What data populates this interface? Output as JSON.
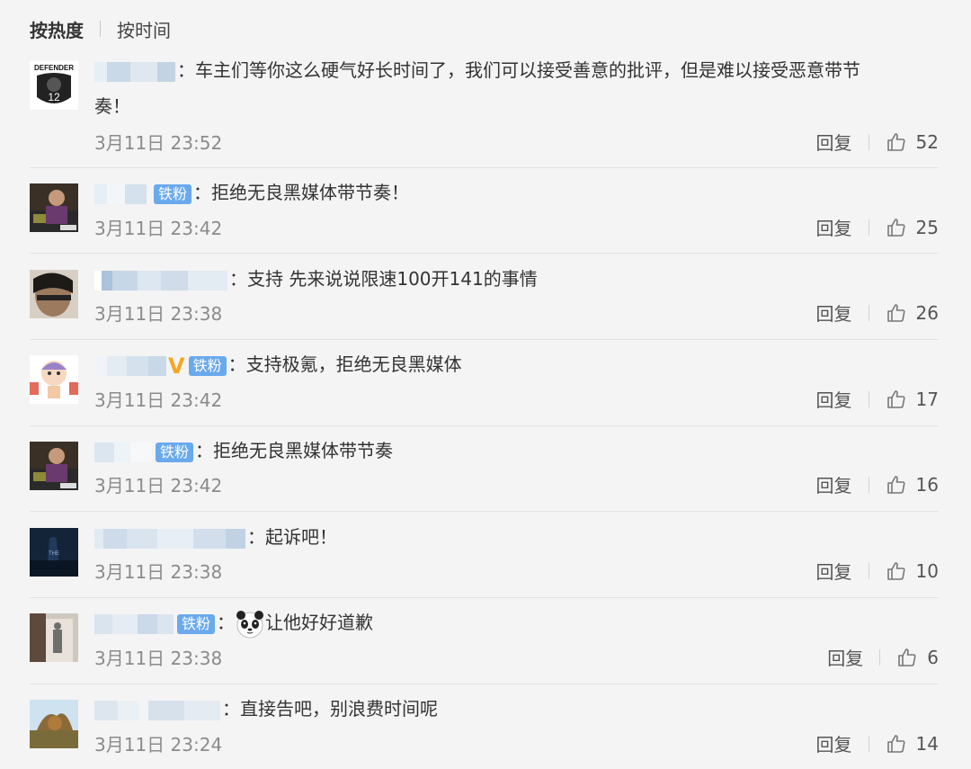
{
  "sort_tabs": {
    "hot": "按热度",
    "time": "按时间"
  },
  "reply_label": "回复",
  "colors": {
    "badge": "#6aa9ec",
    "vip": "#f5a623",
    "divider": "#e3e3e3"
  },
  "comments": [
    {
      "badge": "",
      "vip": false,
      "text": "车主们等你这么硬气好长时间了，我们可以接受善意的批评，但是难以接受恶意带节",
      "text2": "奏！",
      "time": "3月11日 23:52",
      "likes": "52",
      "avatar": "defender-logo"
    },
    {
      "badge": "铁粉",
      "vip": false,
      "text": "拒绝无良黑媒体带节奏！",
      "time": "3月11日 23:42",
      "likes": "25",
      "avatar": "person-photo"
    },
    {
      "badge": "",
      "vip": false,
      "text": "支持 先来说说限速100开141的事情",
      "time": "3月11日 23:38",
      "likes": "26",
      "avatar": "person-face"
    },
    {
      "badge": "铁粉",
      "vip": true,
      "text": "支持极氪，拒绝无良黑媒体",
      "time": "3月11日 23:42",
      "likes": "17",
      "avatar": "cartoon-kid"
    },
    {
      "badge": "铁粉",
      "vip": false,
      "text": "拒绝无良黑媒体带节奏",
      "time": "3月11日 23:42",
      "likes": "16",
      "avatar": "person-photo"
    },
    {
      "badge": "",
      "vip": false,
      "text": "起诉吧！",
      "time": "3月11日 23:38",
      "likes": "10",
      "avatar": "dark-night"
    },
    {
      "badge": "铁粉",
      "vip": false,
      "text": "让他好好道歉",
      "time": "3月11日 23:38",
      "likes": "6",
      "avatar": "doorway",
      "emoji": "panda"
    },
    {
      "badge": "",
      "vip": false,
      "text": "直接告吧，别浪费时间呢",
      "time": "3月11日 23:24",
      "likes": "14",
      "avatar": "landscape"
    }
  ]
}
